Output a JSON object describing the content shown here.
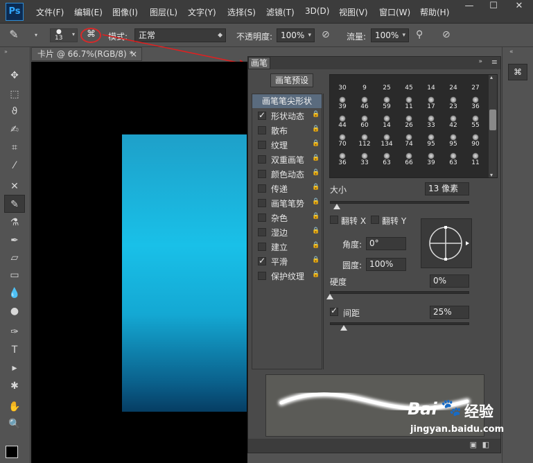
{
  "app": {
    "logo": "Ps"
  },
  "menu": [
    "文件(F)",
    "编辑(E)",
    "图像(I)",
    "图层(L)",
    "文字(Y)",
    "选择(S)",
    "滤镜(T)",
    "3D(D)",
    "视图(V)",
    "窗口(W)",
    "帮助(H)"
  ],
  "window_controls": {
    "minimize": "—",
    "maximize": "☐",
    "close": "✕"
  },
  "options": {
    "brush_size": "13",
    "mode_label": "模式:",
    "mode_value": "正常",
    "opacity_label": "不透明度:",
    "opacity_value": "100%",
    "flow_label": "流量:",
    "flow_value": "100%"
  },
  "document": {
    "tab_title": "卡片 @ 66.7%(RGB/8) *",
    "close": "×"
  },
  "brush_panel": {
    "tab": "画笔",
    "preset_button": "画笔预设",
    "tip_shape": "画笔笔尖形状",
    "options": [
      {
        "label": "形状动态",
        "checked": true
      },
      {
        "label": "散布",
        "checked": false
      },
      {
        "label": "纹理",
        "checked": false
      },
      {
        "label": "双重画笔",
        "checked": false
      },
      {
        "label": "颜色动态",
        "checked": false
      },
      {
        "label": "传递",
        "checked": false
      },
      {
        "label": "画笔笔势",
        "checked": false
      },
      {
        "label": "杂色",
        "checked": false
      },
      {
        "label": "湿边",
        "checked": false
      },
      {
        "label": "建立",
        "checked": false
      },
      {
        "label": "平滑",
        "checked": true
      },
      {
        "label": "保护纹理",
        "checked": false
      }
    ],
    "brush_sizes": [
      [
        "30",
        "9",
        "25",
        "45",
        "14",
        "24",
        "27"
      ],
      [
        "39",
        "46",
        "59",
        "11",
        "17",
        "23",
        "36"
      ],
      [
        "44",
        "60",
        "14",
        "26",
        "33",
        "42",
        "55"
      ],
      [
        "70",
        "112",
        "134",
        "74",
        "95",
        "95",
        "90"
      ],
      [
        "36",
        "33",
        "63",
        "66",
        "39",
        "63",
        "11"
      ]
    ],
    "size_label": "大小",
    "size_value": "13 像素",
    "size_level": 0.05,
    "flip_x": "翻转 X",
    "flip_y": "翻转 Y",
    "angle_label": "角度:",
    "angle_value": "0°",
    "roundness_label": "圆度:",
    "roundness_value": "100%",
    "hardness_label": "硬度",
    "hardness_value": "0%",
    "hardness_level": 0,
    "spacing_label": "间距",
    "spacing_checked": true,
    "spacing_value": "25%",
    "spacing_level": 0.1
  },
  "watermark": {
    "brand": "Bai",
    "brand2": "经验",
    "url": "jingyan.baidu.com"
  }
}
